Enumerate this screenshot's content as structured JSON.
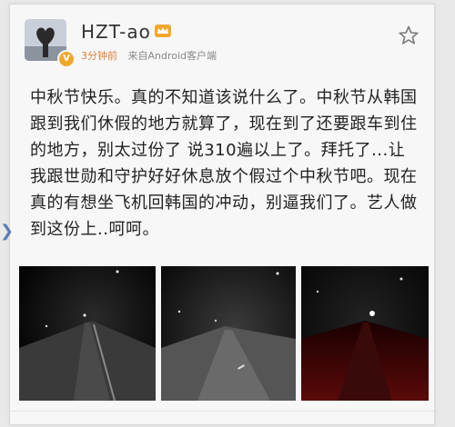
{
  "post": {
    "username": "HZT-ao",
    "time": "3分钟前",
    "source": "来自Android客户端",
    "text": "中秋节快乐。真的不知道该说什么了。中秋节从韩国跟到我们休假的地方就算了，现在到了还要跟车到住的地方，别太过份了 说310遍以上了。拜托了...让我跟世勋和守护好好休息放个假过个中秋节吧。现在真的有想坐飞机回韩国的冲动，别逼我们了。艺人做到这份上..呵呵。",
    "photos": [
      {
        "name": "night-road-photo-1"
      },
      {
        "name": "night-road-photo-2"
      },
      {
        "name": "night-road-photo-3"
      }
    ]
  },
  "icons": {
    "crown": "crown-icon",
    "star": "star-icon",
    "verified": "verified-badge-icon",
    "arrow": "chevron-left-icon"
  },
  "colors": {
    "time_accent": "#e0803a",
    "crown_accent": "#f2a72a"
  }
}
